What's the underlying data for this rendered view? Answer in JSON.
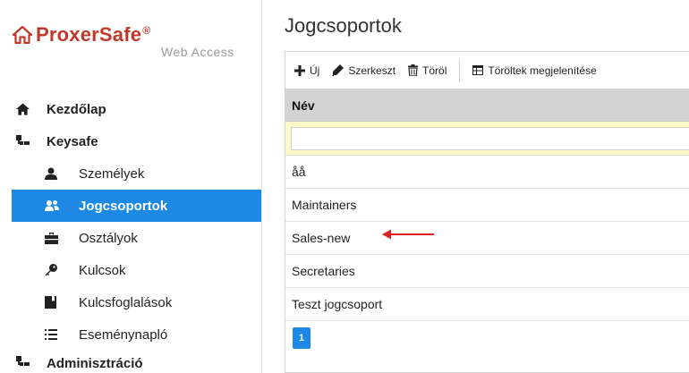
{
  "brand": {
    "name": "ProxerSafe",
    "registered": "®",
    "subtitle": "Web Access"
  },
  "colors": {
    "brand_red": "#c0392b",
    "accent_blue": "#1e88e5",
    "header_gray": "#d3d3d3",
    "filter_yellow": "#fff8c7",
    "arrow_red": "#e02020"
  },
  "sidebar": {
    "items": [
      {
        "label": "Kezdőlap",
        "icon": "home-icon",
        "level": "top"
      },
      {
        "label": "Keysafe",
        "icon": "sitemap-icon",
        "level": "top"
      },
      {
        "label": "Személyek",
        "icon": "user-icon",
        "level": "sub"
      },
      {
        "label": "Jogcsoportok",
        "icon": "users-icon",
        "level": "sub",
        "active": true
      },
      {
        "label": "Osztályok",
        "icon": "briefcase-icon",
        "level": "sub"
      },
      {
        "label": "Kulcsok",
        "icon": "key-icon",
        "level": "sub"
      },
      {
        "label": "Kulcsfoglalások",
        "icon": "bookmark-icon",
        "level": "sub"
      },
      {
        "label": "Eseménynapló",
        "icon": "list-icon",
        "level": "sub"
      },
      {
        "label": "Adminisztráció",
        "icon": "sitemap-icon",
        "level": "top"
      }
    ]
  },
  "main": {
    "title": "Jogcsoportok",
    "toolbar": {
      "new_label": "Új",
      "edit_label": "Szerkeszt",
      "delete_label": "Töröl",
      "show_deleted_label": "Töröltek megjelenítése"
    },
    "table": {
      "column": "Név",
      "filter_value": "",
      "rows": [
        "åå",
        "Maintainers",
        "Sales-new",
        "Secretaries",
        "Teszt jogcsoport"
      ],
      "highlighted_row": "Sales-new"
    },
    "pager": {
      "current_page": "1"
    }
  }
}
